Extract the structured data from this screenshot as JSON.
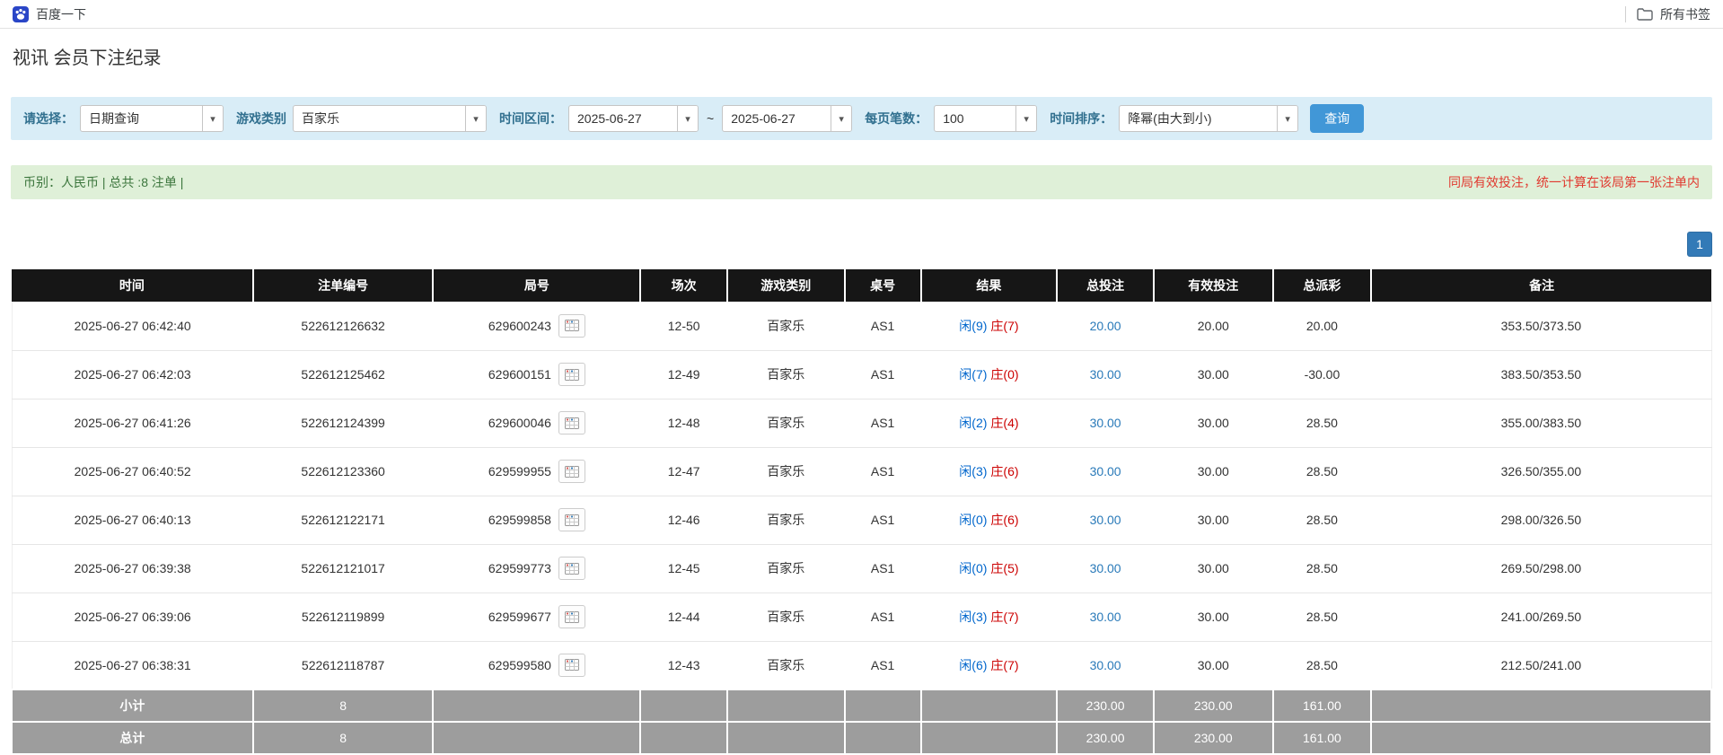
{
  "colors": {
    "accent": "#337ab7",
    "button_blue": "#4197d7",
    "filter_bg": "#d9edf7",
    "label_blue": "#31708f",
    "summary_bg": "#dff0d8",
    "summary_text": "#3c763d",
    "warning_red": "#e03a30",
    "negative_red": "#e03a30",
    "header_bg": "#161616",
    "footer_bg": "#9d9d9d",
    "player_blue": "#0066cc",
    "banker_red": "#cc0000",
    "link_blue": "#2a7ab9"
  },
  "icons": {
    "chevron_down": "▾"
  },
  "bookmarks_bar": {
    "bookmark_label": "百度一下",
    "all_bookmarks_label": "所有书签"
  },
  "page": {
    "title": "视讯 会员下注纪录"
  },
  "filters": {
    "select_label": "请选择：",
    "select_value": "日期查询",
    "game_type_label": "游戏类别",
    "game_type_value": "百家乐",
    "date_range_label": "时间区间：",
    "date_from": "2025-06-27",
    "range_separator": "~",
    "date_to": "2025-06-27",
    "page_size_label": "每页笔数：",
    "page_size_value": "100",
    "sort_label": "时间排序：",
    "sort_value": "降幂(由大到小)",
    "search_button_label": "查询"
  },
  "summary": {
    "left_text": "币别：人民币 | 总共 :8 注单 |",
    "right_text": "同局有效投注，统一计算在该局第一张注单内"
  },
  "pagination": {
    "current_page": "1"
  },
  "table": {
    "headers": [
      "时间",
      "注单编号",
      "局号",
      "场次",
      "游戏类别",
      "桌号",
      "结果",
      "总投注",
      "有效投注",
      "总派彩",
      "备注"
    ],
    "rows": [
      {
        "time": "2025-06-27 06:42:40",
        "bet_id": "522612126632",
        "round_id": "629600243",
        "session": "12-50",
        "game": "百家乐",
        "table_no": "AS1",
        "result_player": "闲(9)",
        "result_banker": "庄(7)",
        "total_bet": "20.00",
        "valid_bet": "20.00",
        "payout": "20.00",
        "note": "353.50/373.50"
      },
      {
        "time": "2025-06-27 06:42:03",
        "bet_id": "522612125462",
        "round_id": "629600151",
        "session": "12-49",
        "game": "百家乐",
        "table_no": "AS1",
        "result_player": "闲(7)",
        "result_banker": "庄(0)",
        "total_bet": "30.00",
        "valid_bet": "30.00",
        "payout": "-30.00",
        "note": "383.50/353.50"
      },
      {
        "time": "2025-06-27 06:41:26",
        "bet_id": "522612124399",
        "round_id": "629600046",
        "session": "12-48",
        "game": "百家乐",
        "table_no": "AS1",
        "result_player": "闲(2)",
        "result_banker": "庄(4)",
        "total_bet": "30.00",
        "valid_bet": "30.00",
        "payout": "28.50",
        "note": "355.00/383.50"
      },
      {
        "time": "2025-06-27 06:40:52",
        "bet_id": "522612123360",
        "round_id": "629599955",
        "session": "12-47",
        "game": "百家乐",
        "table_no": "AS1",
        "result_player": "闲(3)",
        "result_banker": "庄(6)",
        "total_bet": "30.00",
        "valid_bet": "30.00",
        "payout": "28.50",
        "note": "326.50/355.00"
      },
      {
        "time": "2025-06-27 06:40:13",
        "bet_id": "522612122171",
        "round_id": "629599858",
        "session": "12-46",
        "game": "百家乐",
        "table_no": "AS1",
        "result_player": "闲(0)",
        "result_banker": "庄(6)",
        "total_bet": "30.00",
        "valid_bet": "30.00",
        "payout": "28.50",
        "note": "298.00/326.50"
      },
      {
        "time": "2025-06-27 06:39:38",
        "bet_id": "522612121017",
        "round_id": "629599773",
        "session": "12-45",
        "game": "百家乐",
        "table_no": "AS1",
        "result_player": "闲(0)",
        "result_banker": "庄(5)",
        "total_bet": "30.00",
        "valid_bet": "30.00",
        "payout": "28.50",
        "note": "269.50/298.00"
      },
      {
        "time": "2025-06-27 06:39:06",
        "bet_id": "522612119899",
        "round_id": "629599677",
        "session": "12-44",
        "game": "百家乐",
        "table_no": "AS1",
        "result_player": "闲(3)",
        "result_banker": "庄(7)",
        "total_bet": "30.00",
        "valid_bet": "30.00",
        "payout": "28.50",
        "note": "241.00/269.50"
      },
      {
        "time": "2025-06-27 06:38:31",
        "bet_id": "522612118787",
        "round_id": "629599580",
        "session": "12-43",
        "game": "百家乐",
        "table_no": "AS1",
        "result_player": "闲(6)",
        "result_banker": "庄(7)",
        "total_bet": "30.00",
        "valid_bet": "30.00",
        "payout": "28.50",
        "note": "212.50/241.00"
      }
    ],
    "subtotal": {
      "label": "小计",
      "count": "8",
      "total_bet": "230.00",
      "valid_bet": "230.00",
      "payout": "161.00"
    },
    "total": {
      "label": "总计",
      "count": "8",
      "total_bet": "230.00",
      "valid_bet": "230.00",
      "payout": "161.00"
    }
  }
}
